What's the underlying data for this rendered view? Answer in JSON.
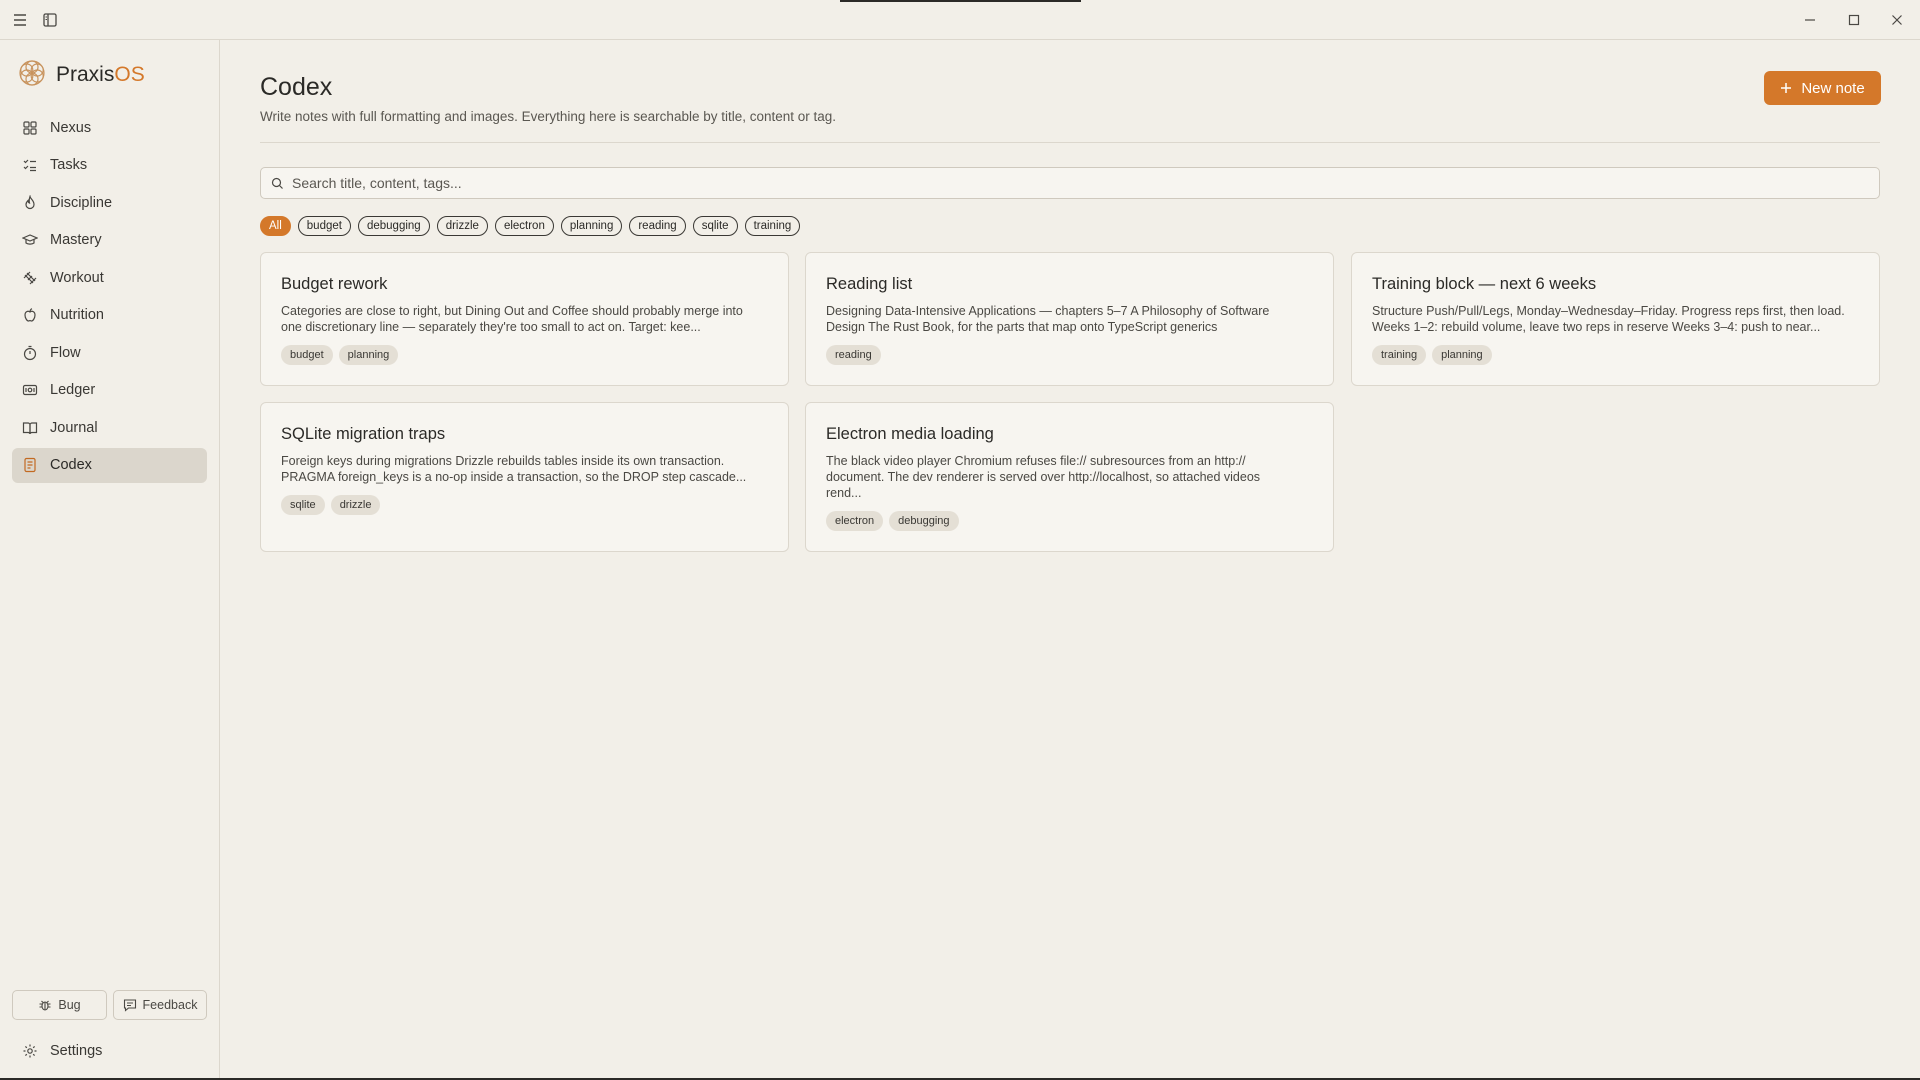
{
  "app": {
    "brand_primary": "Praxis",
    "brand_accent": "OS",
    "accent_color": "#d4782a"
  },
  "titlebar": {
    "menu_icon": "hamburger-icon",
    "panel_icon": "sidebar-toggle-icon",
    "window_controls": [
      "minimize-icon",
      "maximize-icon",
      "close-icon"
    ]
  },
  "sidebar": {
    "items": [
      {
        "label": "Nexus",
        "icon": "grid-icon"
      },
      {
        "label": "Tasks",
        "icon": "checklist-icon"
      },
      {
        "label": "Discipline",
        "icon": "flame-icon"
      },
      {
        "label": "Mastery",
        "icon": "graduation-cap-icon"
      },
      {
        "label": "Workout",
        "icon": "dumbbell-icon"
      },
      {
        "label": "Nutrition",
        "icon": "apple-icon"
      },
      {
        "label": "Flow",
        "icon": "timer-icon"
      },
      {
        "label": "Ledger",
        "icon": "wallet-icon"
      },
      {
        "label": "Journal",
        "icon": "book-icon"
      },
      {
        "label": "Codex",
        "icon": "notebook-icon",
        "active": true
      }
    ],
    "bug_label": "Bug",
    "feedback_label": "Feedback",
    "settings_label": "Settings"
  },
  "main": {
    "title": "Codex",
    "subtitle": "Write notes with full formatting and images. Everything here is searchable by title, content or tag.",
    "new_note_label": "New note",
    "search": {
      "placeholder": "Search title, content, tags..."
    },
    "filters": [
      "All",
      "budget",
      "debugging",
      "drizzle",
      "electron",
      "planning",
      "reading",
      "sqlite",
      "training"
    ],
    "active_filter": "All",
    "notes": [
      {
        "title": "Budget rework",
        "text_line1": "Categories are close to right, but Dining Out and Coffee should probably merge into",
        "text_line2": "one discretionary line — separately they're too small to act on. Target: kee...",
        "text_line3": "",
        "tags": [
          "budget",
          "planning"
        ]
      },
      {
        "title": "Reading list",
        "text_line1": "Designing Data-Intensive Applications — chapters 5–7 A Philosophy of Software",
        "text_line2": "Design The Rust Book, for the parts that map onto TypeScript generics",
        "text_line3": "",
        "tags": [
          "reading"
        ]
      },
      {
        "title": "Training block — next 6 weeks",
        "text_line1": "Structure Push/Pull/Legs, Monday–Wednesday–Friday. Progress reps first, then load.",
        "text_line2": "Weeks 1–2: rebuild volume, leave two reps in reserve Weeks 3–4: push to near...",
        "text_line3": "",
        "tags": [
          "training",
          "planning"
        ]
      },
      {
        "title": "SQLite migration traps",
        "text_line1": "Foreign keys during migrations Drizzle rebuilds tables inside its own transaction.",
        "text_line2": "PRAGMA foreign_keys is a no-op inside a transaction, so the DROP step cascade...",
        "text_line3": "",
        "tags": [
          "sqlite",
          "drizzle"
        ]
      },
      {
        "title": "Electron media loading",
        "text_line1": "The black video player Chromium refuses file:// subresources from an http://",
        "text_line2": "document. The dev renderer is served over http://localhost, so attached videos",
        "text_line3": "rend...",
        "tags": [
          "electron",
          "debugging"
        ]
      }
    ]
  }
}
